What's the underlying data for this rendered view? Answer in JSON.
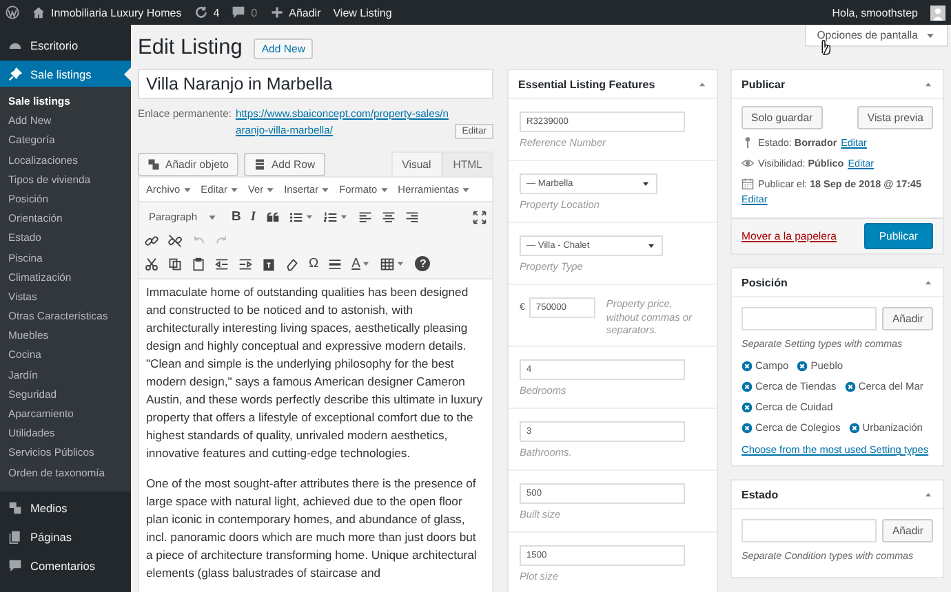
{
  "admin_bar": {
    "site": "Inmobiliaria Luxury Homes",
    "updates": "4",
    "comments": "0",
    "add": "Añadir",
    "view": "View Listing",
    "greeting": "Hola, smoothstep"
  },
  "sidebar": {
    "items": [
      {
        "label": "Escritorio",
        "selected": false
      },
      {
        "label": "Sale listings",
        "selected": true,
        "children": [
          {
            "label": "Sale listings",
            "selected": true
          },
          {
            "label": "Add New",
            "selected": false
          },
          {
            "label": "Categoría",
            "selected": false
          },
          {
            "label": "Localizaciones",
            "selected": false
          },
          {
            "label": "Tipos de vivienda",
            "selected": false
          },
          {
            "label": "Posición",
            "selected": false
          },
          {
            "label": "Orientación",
            "selected": false
          },
          {
            "label": "Estado",
            "selected": false
          },
          {
            "label": "Piscina",
            "selected": false
          },
          {
            "label": "Climatización",
            "selected": false
          },
          {
            "label": "Vistas",
            "selected": false
          },
          {
            "label": "Otras Características",
            "selected": false
          },
          {
            "label": "Muebles",
            "selected": false
          },
          {
            "label": "Cocina",
            "selected": false
          },
          {
            "label": "Jardín",
            "selected": false
          },
          {
            "label": "Seguridad",
            "selected": false
          },
          {
            "label": "Aparcamiento",
            "selected": false
          },
          {
            "label": "Utilidades",
            "selected": false
          },
          {
            "label": "Servicios Públicos",
            "selected": false
          },
          {
            "label": "Orden de taxonomía",
            "selected": false
          }
        ]
      },
      {
        "label": "Medios",
        "selected": false
      },
      {
        "label": "Páginas",
        "selected": false
      },
      {
        "label": "Comentarios",
        "selected": false
      }
    ]
  },
  "screen_options": "Opciones de pantalla",
  "page": {
    "title": "Edit Listing",
    "add_new": "Add New"
  },
  "post": {
    "title": "Villa Naranjo in Marbella",
    "permalink_label": "Enlace permanente:",
    "permalink_url": "https://www.sbaiconcept.com/property-sales/naranjo-villa-marbella/",
    "edit": "Editar"
  },
  "editor": {
    "buttons": [
      "Añadir objeto",
      "Add Row"
    ],
    "tabs": [
      {
        "label": "Visual",
        "selected": true
      },
      {
        "label": "HTML",
        "selected": false
      }
    ],
    "menus": [
      "Archivo",
      "Editar",
      "Ver",
      "Insertar",
      "Formato",
      "Herramientas"
    ],
    "format": "Paragraph",
    "toolbar_glyphs": [
      "B",
      "I",
      "Ω",
      "A",
      "?"
    ],
    "paragraphs": [
      "Immaculate home of outstanding qualities has been designed and constructed to be noticed and to astonish, with architecturally interesting living spaces, aesthetically pleasing design and highly conceptual and expressive modern details. \"Clean and simple is the underlying philosophy for the best modern design,\" says a famous American designer Cameron Austin, and these words perfectly describe this ultimate in luxury property that offers a lifestyle of exceptional comfort due to the highest standards of quality, unrivaled modern aesthetics, innovative features and cutting-edge technologies.",
      "One of the most sought-after attributes there is the presence of large space with natural light, achieved due to the open floor plan iconic in contemporary homes, and abundance of glass, incl. panoramic doors which are much more than just doors but a piece of architecture transforming home. Unique architectural elements (glass balustrades of staircase and"
    ]
  },
  "features": {
    "title": "Essential Listing Features",
    "items": [
      {
        "kind": "text",
        "value": "R3239000",
        "caption": "Reference Number"
      },
      {
        "kind": "select",
        "value": "— Marbella",
        "caption": "Property Location"
      },
      {
        "kind": "select",
        "value": "— Villa - Chalet",
        "caption": "Property Type"
      },
      {
        "kind": "price",
        "currency": "€",
        "value": "750000",
        "caption": "Property price, without commas or separators."
      },
      {
        "kind": "text",
        "value": "4",
        "caption": "Bedrooms"
      },
      {
        "kind": "text",
        "value": "3",
        "caption": "Bathrooms."
      },
      {
        "kind": "text",
        "value": "500",
        "caption": "Built size"
      },
      {
        "kind": "text",
        "value": "1500",
        "caption": "Plot size"
      }
    ]
  },
  "publish": {
    "title": "Publicar",
    "save": "Solo guardar",
    "preview": "Vista previa",
    "lines": [
      {
        "text": "Estado: **Borrador**",
        "link": "Editar"
      },
      {
        "text": "Visibilidad: **Público**",
        "link": "Editar"
      },
      {
        "text": "Publicar el: **18 Sep de 2018 @ 17:45**",
        "link": "Editar"
      }
    ],
    "trash": "Mover a la papelera",
    "publish": "Publicar"
  },
  "taxonomies": [
    {
      "title": "Posición",
      "button": "Añadir",
      "hint": "Separate Setting types with commas",
      "tags": [
        "Campo",
        "Pueblo",
        "Cerca de Tiendas",
        "Cerca del Mar",
        "Cerca de Cuidad",
        "Cerca de Colegios",
        "Urbanización"
      ],
      "link": "Choose from the most used Setting types"
    },
    {
      "title": "Estado",
      "button": "Añadir",
      "hint": "Separate Condition types with commas"
    }
  ]
}
